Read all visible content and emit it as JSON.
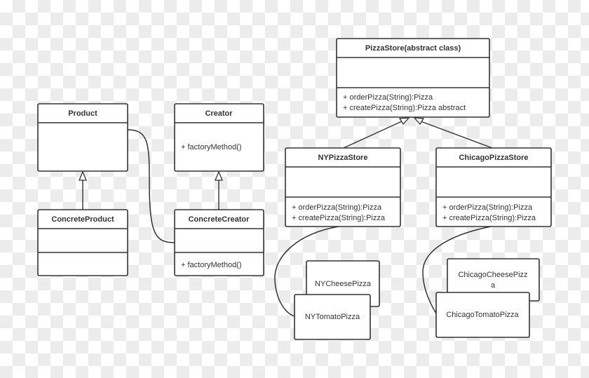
{
  "classes": {
    "product": {
      "name": "Product"
    },
    "creator": {
      "name": "Creator",
      "methods": [
        "+ factoryMethod()"
      ]
    },
    "concrete_product": {
      "name": "ConcreteProduct"
    },
    "concrete_creator": {
      "name": "ConcreteCreator",
      "methods": [
        "+ factoryMethod()"
      ]
    },
    "pizza_store": {
      "name": "PizzaStore(abstract class)",
      "methods": [
        "+ orderPizza(String):Pizza",
        "+ createPizza(String):Pizza abstract"
      ]
    },
    "ny_pizza_store": {
      "name": "NYPizzaStore",
      "methods": [
        "+ orderPizza(String):Pizza",
        "+ createPizza(String):Pizza"
      ]
    },
    "chicago_pizza_store": {
      "name": "ChicagoPizzaStore",
      "methods": [
        "+ orderPizza(String):Pizza",
        "+ createPizza(String):Pizza"
      ]
    }
  },
  "notes": {
    "ny_cheese": "NYCheesePizza",
    "ny_tomato": "NYTomatoPizza",
    "chicago_cheese_1": "ChicagoCheesePizz",
    "chicago_cheese_2": "a",
    "chicago_tomato": "ChicagoTomatoPizza"
  }
}
